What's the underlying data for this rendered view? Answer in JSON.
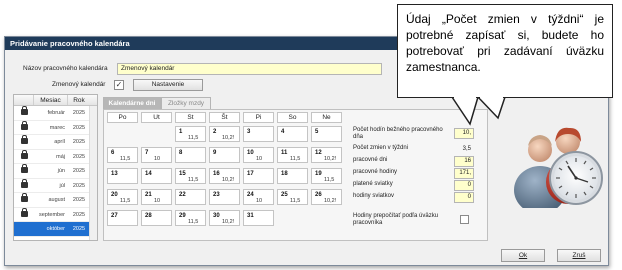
{
  "window": {
    "title": "Pridávanie pracovného kalendára"
  },
  "form": {
    "name_label": "Názov pracovného kalendára",
    "name_value": "Zmenový kalendár",
    "shift_label": "Zmenový kalendár",
    "shift_checked": "✓",
    "settings_button": "Nastavenie"
  },
  "months": {
    "headers": [
      "Mesiac",
      "Rok"
    ],
    "rows": [
      {
        "month": "február",
        "year": "2025",
        "locked": true,
        "selected": false
      },
      {
        "month": "marec",
        "year": "2025",
        "locked": true,
        "selected": false
      },
      {
        "month": "apríl",
        "year": "2025",
        "locked": true,
        "selected": false
      },
      {
        "month": "máj",
        "year": "2025",
        "locked": true,
        "selected": false
      },
      {
        "month": "jún",
        "year": "2025",
        "locked": true,
        "selected": false
      },
      {
        "month": "júl",
        "year": "2025",
        "locked": true,
        "selected": false
      },
      {
        "month": "august",
        "year": "2025",
        "locked": true,
        "selected": false
      },
      {
        "month": "september",
        "year": "2025",
        "locked": true,
        "selected": false
      },
      {
        "month": "október",
        "year": "2025",
        "locked": false,
        "selected": true
      },
      {
        "month": "november",
        "year": "2025",
        "locked": false,
        "selected": false
      }
    ]
  },
  "tabs": {
    "calendar_days": "Kalendárne dni",
    "wage_supplements": "Zložky mzdy"
  },
  "calendar": {
    "weekdays": [
      "Po",
      "Ut",
      "St",
      "Št",
      "Pi",
      "So",
      "Ne"
    ],
    "days": [
      {
        "day": "1",
        "hours": "11,5"
      },
      {
        "day": "2",
        "hours": "10,2!"
      },
      {
        "day": "3",
        "hours": ""
      },
      {
        "day": "4",
        "hours": ""
      },
      {
        "day": "5",
        "hours": ""
      },
      {
        "day": "6",
        "hours": "11,5"
      },
      {
        "day": "7",
        "hours": "10"
      },
      {
        "day": "8",
        "hours": ""
      },
      {
        "day": "9",
        "hours": ""
      },
      {
        "day": "10",
        "hours": "10"
      },
      {
        "day": "11",
        "hours": "11,5"
      },
      {
        "day": "12",
        "hours": "10,2!"
      },
      {
        "day": "13",
        "hours": ""
      },
      {
        "day": "14",
        "hours": ""
      },
      {
        "day": "15",
        "hours": "11,5"
      },
      {
        "day": "16",
        "hours": "10,2!"
      },
      {
        "day": "17",
        "hours": ""
      },
      {
        "day": "18",
        "hours": ""
      },
      {
        "day": "19",
        "hours": "11,5"
      },
      {
        "day": "20",
        "hours": "11,5"
      },
      {
        "day": "21",
        "hours": "10"
      },
      {
        "day": "22",
        "hours": ""
      },
      {
        "day": "23",
        "hours": ""
      },
      {
        "day": "24",
        "hours": "10"
      },
      {
        "day": "25",
        "hours": "11,5"
      },
      {
        "day": "26",
        "hours": "10,2!"
      },
      {
        "day": "27",
        "hours": ""
      },
      {
        "day": "28",
        "hours": ""
      },
      {
        "day": "29",
        "hours": "11,5"
      },
      {
        "day": "30",
        "hours": "10,2!"
      },
      {
        "day": "31",
        "hours": ""
      }
    ]
  },
  "stats": {
    "rows": [
      {
        "label": "Počet hodín bežného pracovného dňa",
        "value": "10,"
      },
      {
        "label": "Počet zmien v týždni",
        "value": "3,5"
      },
      {
        "label": "pracovné dni",
        "value": "16"
      },
      {
        "label": "pracovné hodiny",
        "value": "171,"
      },
      {
        "label": "platené sviatky",
        "value": "0"
      },
      {
        "label": "hodiny sviatkov",
        "value": "0"
      }
    ],
    "recalc_label": "Hodiny prepočítať podľa úväzku pracovníka"
  },
  "buttons": {
    "ok": "Ok",
    "cancel": "Zruš"
  },
  "callout": {
    "text": "Údaj „Počet zmien v týždni“ je potrebné zapísať si, budete ho potrebovať pri zadávaní úväzku zamestnanca."
  },
  "colors": {
    "titlebar": "#1f3b5a",
    "input_fill": "#ffffcc",
    "selection": "#1f6fd0"
  }
}
